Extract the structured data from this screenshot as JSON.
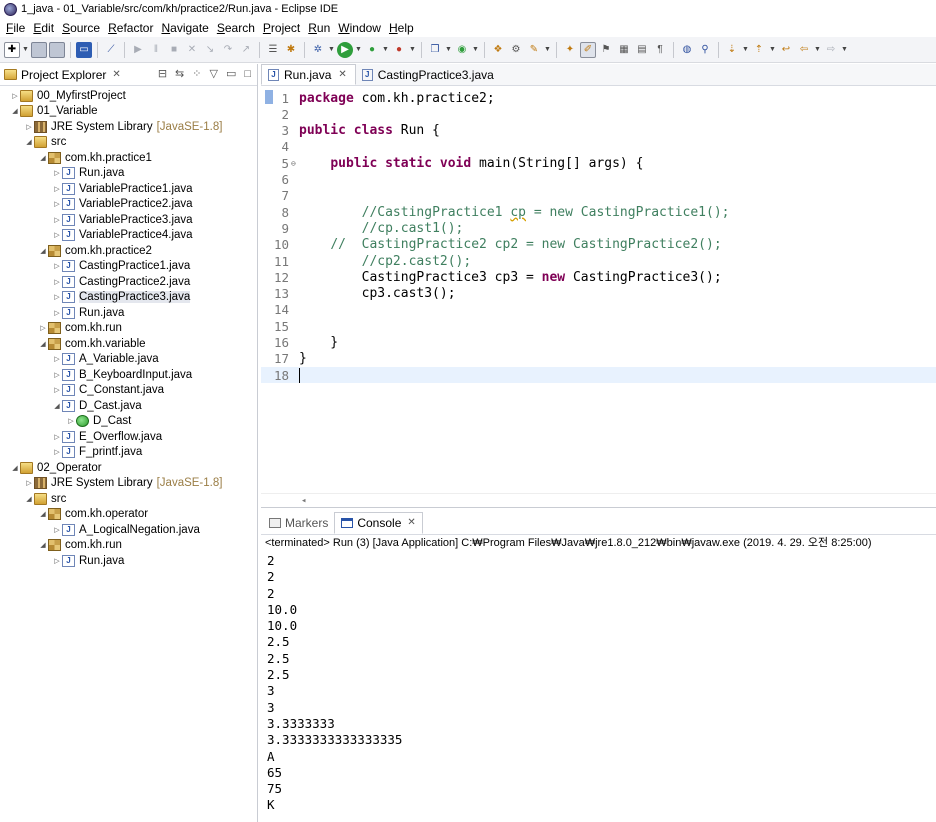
{
  "window": {
    "title": "1_java - 01_Variable/src/com/kh/practice2/Run.java - Eclipse IDE"
  },
  "menu": [
    "File",
    "Edit",
    "Source",
    "Refactor",
    "Navigate",
    "Search",
    "Project",
    "Run",
    "Window",
    "Help"
  ],
  "explorer": {
    "title": "Project Explorer",
    "tree": [
      {
        "label": "00_MyfirstProject",
        "level": 0,
        "icon": "project",
        "twisty": "collapsed"
      },
      {
        "label": "01_Variable",
        "level": 0,
        "icon": "project",
        "twisty": "expanded"
      },
      {
        "label": "JRE System Library",
        "suffix": "[JavaSE-1.8]",
        "level": 1,
        "icon": "library",
        "twisty": "collapsed"
      },
      {
        "label": "src",
        "level": 1,
        "icon": "folder-src",
        "twisty": "expanded"
      },
      {
        "label": "com.kh.practice1",
        "level": 2,
        "icon": "package",
        "twisty": "expanded"
      },
      {
        "label": "Run.java",
        "level": 3,
        "icon": "java",
        "twisty": "collapsed"
      },
      {
        "label": "VariablePractice1.java",
        "level": 3,
        "icon": "java",
        "twisty": "collapsed"
      },
      {
        "label": "VariablePractice2.java",
        "level": 3,
        "icon": "java",
        "twisty": "collapsed"
      },
      {
        "label": "VariablePractice3.java",
        "level": 3,
        "icon": "java",
        "twisty": "collapsed"
      },
      {
        "label": "VariablePractice4.java",
        "level": 3,
        "icon": "java",
        "twisty": "collapsed"
      },
      {
        "label": "com.kh.practice2",
        "level": 2,
        "icon": "package",
        "twisty": "expanded"
      },
      {
        "label": "CastingPractice1.java",
        "level": 3,
        "icon": "java",
        "twisty": "collapsed"
      },
      {
        "label": "CastingPractice2.java",
        "level": 3,
        "icon": "java",
        "twisty": "collapsed"
      },
      {
        "label": "CastingPractice3.java",
        "level": 3,
        "icon": "java",
        "twisty": "collapsed",
        "selected": true
      },
      {
        "label": "Run.java",
        "level": 3,
        "icon": "java",
        "twisty": "collapsed"
      },
      {
        "label": "com.kh.run",
        "level": 2,
        "icon": "package",
        "twisty": "collapsed"
      },
      {
        "label": "com.kh.variable",
        "level": 2,
        "icon": "package",
        "twisty": "expanded"
      },
      {
        "label": "A_Variable.java",
        "level": 3,
        "icon": "java",
        "twisty": "collapsed"
      },
      {
        "label": "B_KeyboardInput.java",
        "level": 3,
        "icon": "java",
        "twisty": "collapsed"
      },
      {
        "label": "C_Constant.java",
        "level": 3,
        "icon": "java",
        "twisty": "collapsed"
      },
      {
        "label": "D_Cast.java",
        "level": 3,
        "icon": "java",
        "twisty": "expanded"
      },
      {
        "label": "D_Cast",
        "level": 4,
        "icon": "class",
        "twisty": "collapsed"
      },
      {
        "label": "E_Overflow.java",
        "level": 3,
        "icon": "java",
        "twisty": "collapsed"
      },
      {
        "label": "F_printf.java",
        "level": 3,
        "icon": "java",
        "twisty": "collapsed"
      },
      {
        "label": "02_Operator",
        "level": 0,
        "icon": "project",
        "twisty": "expanded"
      },
      {
        "label": "JRE System Library",
        "suffix": "[JavaSE-1.8]",
        "level": 1,
        "icon": "library",
        "twisty": "collapsed"
      },
      {
        "label": "src",
        "level": 1,
        "icon": "folder-src",
        "twisty": "expanded"
      },
      {
        "label": "com.kh.operator",
        "level": 2,
        "icon": "package",
        "twisty": "expanded"
      },
      {
        "label": "A_LogicalNegation.java",
        "level": 3,
        "icon": "java",
        "twisty": "collapsed"
      },
      {
        "label": "com.kh.run",
        "level": 2,
        "icon": "package",
        "twisty": "expanded"
      },
      {
        "label": "Run.java",
        "level": 3,
        "icon": "java",
        "twisty": "collapsed"
      }
    ]
  },
  "editor": {
    "tabs": [
      {
        "label": "Run.java",
        "active": true
      },
      {
        "label": "CastingPractice3.java",
        "active": false
      }
    ],
    "lines": [
      {
        "n": "1",
        "code": "<span class='kw'>package</span> com.kh.practice2;"
      },
      {
        "n": "2",
        "code": ""
      },
      {
        "n": "3",
        "code": "<span class='kw'>public class</span> Run {"
      },
      {
        "n": "4",
        "code": ""
      },
      {
        "n": "5",
        "fold": true,
        "code": "    <span class='kw'>public static void</span> main(String[] args) {"
      },
      {
        "n": "6",
        "code": ""
      },
      {
        "n": "7",
        "code": ""
      },
      {
        "n": "8",
        "code": "        <span class='cm'>//CastingPractice1 <span class='squiggle'>cp</span> = new CastingPractice1();</span>"
      },
      {
        "n": "9",
        "code": "        <span class='cm'>//cp.cast1();</span>"
      },
      {
        "n": "10",
        "code": "    <span class='cm'>//  CastingPractice2 cp2 = new CastingPractice2();</span>"
      },
      {
        "n": "11",
        "code": "        <span class='cm'>//cp2.cast2();</span>"
      },
      {
        "n": "12",
        "code": "        CastingPractice3 cp3 = <span class='kw'>new</span> CastingPractice3();"
      },
      {
        "n": "13",
        "code": "        cp3.cast3();"
      },
      {
        "n": "14",
        "code": ""
      },
      {
        "n": "15",
        "code": ""
      },
      {
        "n": "16",
        "code": "    }"
      },
      {
        "n": "17",
        "code": "}"
      },
      {
        "n": "18",
        "code": "<span class='caret'></span>",
        "current": true
      }
    ]
  },
  "console": {
    "tabs": [
      {
        "label": "Markers",
        "active": false
      },
      {
        "label": "Console",
        "active": true
      }
    ],
    "status": "<terminated> Run (3) [Java Application] C:₩Program Files₩Java₩jre1.8.0_212₩bin₩javaw.exe (2019. 4. 29. 오전 8:25:00)",
    "output": [
      "2",
      "2",
      "2",
      "10.0",
      "10.0",
      "2.5",
      "2.5",
      "2.5",
      "3",
      "3",
      "3.3333333",
      "3.3333333333333335",
      "A",
      "65",
      "75",
      "K"
    ]
  }
}
